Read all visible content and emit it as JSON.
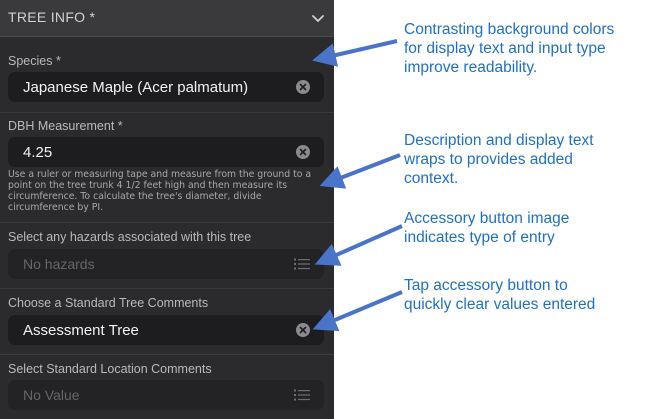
{
  "section": {
    "title": "TREE INFO *"
  },
  "species": {
    "label": "Species *",
    "value": "Japanese Maple (Acer palmatum)"
  },
  "dbh": {
    "label": "DBH Measurement *",
    "value": "4.25",
    "description": "Use a ruler or measuring tape and measure from the ground to a point on the tree trunk 4 1/2 feet high and then measure its circumference. To calculate the tree's diameter, divide circumference by PI."
  },
  "hazards": {
    "label": "Select any hazards associated with this tree",
    "placeholder": "No hazards"
  },
  "tree_comments": {
    "label": "Choose a  Standard Tree Comments",
    "value": "Assessment Tree"
  },
  "location_comments": {
    "label": "Select Standard Location Comments",
    "placeholder": "No Value"
  },
  "annotations": {
    "a1": [
      "Contrasting background colors",
      "for display text and input type",
      "improve readability."
    ],
    "a2": [
      "Description and display text",
      "wraps to provides added",
      "context."
    ],
    "a3": [
      "Accessory button image",
      "indicates type of entry"
    ],
    "a4": [
      "Tap accessory button to",
      "quickly clear values entered"
    ]
  },
  "colors": {
    "accent": "#1f6fc9",
    "arrow": "#4a74c9",
    "panel": "#2b2b2d",
    "field": "#1d1d1f"
  }
}
